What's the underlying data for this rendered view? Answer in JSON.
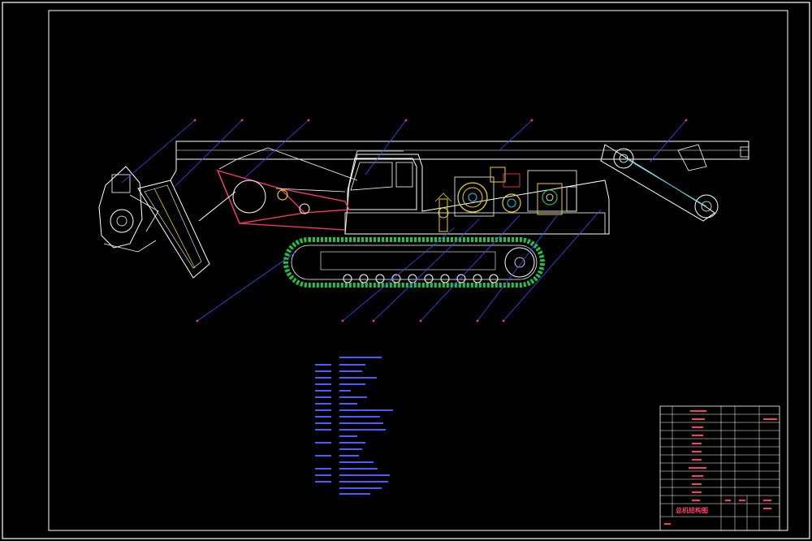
{
  "drawing": {
    "title_block_name": "总机结构图",
    "colors": {
      "background": "#000000",
      "frame": "#ffffff",
      "leader": "#3b4bff",
      "track": "#22c24a",
      "linkage": "#ff3b6b",
      "cyan": "#27c4d8",
      "yellow": "#e8d21a",
      "magenta": "#d62ad6",
      "text_red": "#ff3b6b",
      "text_blue": "#4b5bff"
    }
  }
}
